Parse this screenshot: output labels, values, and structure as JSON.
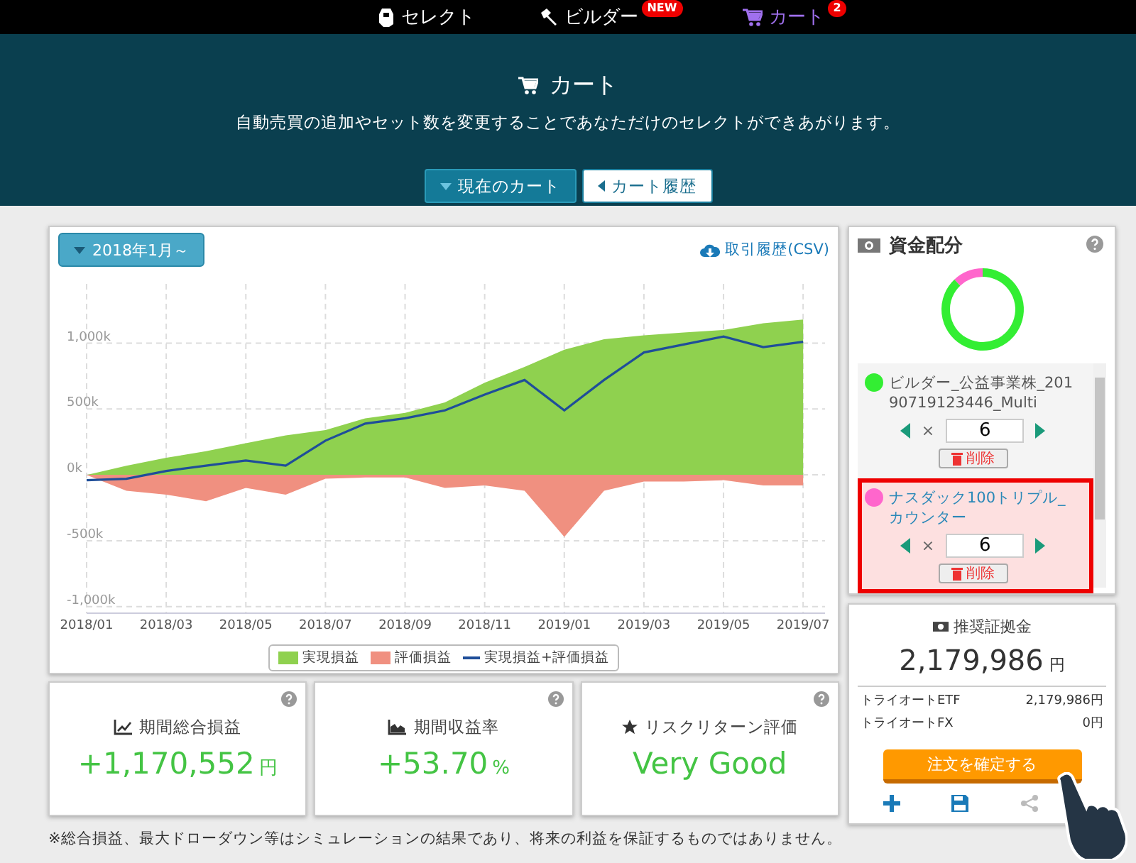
{
  "nav": {
    "items": [
      {
        "kind": "select",
        "label": "セレクト",
        "selected": false
      },
      {
        "kind": "builder",
        "label": "ビルダー",
        "badge": "NEW",
        "selected": false
      },
      {
        "kind": "cart",
        "label": "カート",
        "badge": "2",
        "selected": true
      }
    ]
  },
  "header": {
    "title": "カート",
    "subtitle": "自動売買の追加やセット数を変更することであなただけのセレクトができあがります。",
    "buttons": [
      {
        "label": "現在のカート",
        "selected": true
      },
      {
        "label": "カート履歴",
        "selected": false
      }
    ]
  },
  "performance": {
    "period_button": "2018年1月～",
    "csv_link": "取引履歴(CSV)",
    "chart_data": {
      "type": "area",
      "categories": [
        "2018/01",
        null,
        "2018/03",
        null,
        "2018/05",
        null,
        "2018/07",
        null,
        "2018/09",
        null,
        "2018/11",
        null,
        "2019/01",
        null,
        "2019/03",
        null,
        "2019/05",
        null,
        "2019/07"
      ],
      "yticks": [
        {
          "value": -1000000,
          "label": "-1,000k"
        },
        {
          "value": -500000,
          "label": "-500k"
        },
        {
          "value": 0,
          "label": "0k"
        },
        {
          "value": 500000,
          "label": "500k"
        },
        {
          "value": 1000000,
          "label": "1,000k"
        }
      ],
      "ylim": [
        -1050000,
        1450000
      ],
      "grid": true,
      "series": [
        {
          "name": "実現損益",
          "type": "area",
          "color": "#8fd14f",
          "values": [
            0,
            70000,
            130000,
            180000,
            240000,
            300000,
            340000,
            430000,
            470000,
            550000,
            700000,
            820000,
            950000,
            1030000,
            1060000,
            1080000,
            1100000,
            1150000,
            1180000
          ]
        },
        {
          "name": "評価損益",
          "type": "area",
          "color": "#f09080",
          "values": [
            0,
            -120000,
            -150000,
            -200000,
            -100000,
            -150000,
            -30000,
            -20000,
            -20000,
            -100000,
            -80000,
            -120000,
            -470000,
            -120000,
            -50000,
            -50000,
            -40000,
            -80000,
            -80000
          ]
        },
        {
          "name": "実現損益+評価損益",
          "type": "line",
          "color": "#1f4e99",
          "values": [
            -40000,
            -30000,
            30000,
            70000,
            110000,
            70000,
            260000,
            390000,
            430000,
            490000,
            610000,
            720000,
            490000,
            720000,
            930000,
            990000,
            1050000,
            970000,
            1010000
          ]
        }
      ]
    }
  },
  "allocation": {
    "title": "資金配分",
    "items": [
      {
        "name": "ビルダー_公益事業株_20190719123446_Multi",
        "color": "#33ee33",
        "quantity": "6",
        "multiplier": "×",
        "delete_label": "削除",
        "selected": false
      },
      {
        "name": "ナスダック100トリプル_カウンター",
        "color": "#ff66cc",
        "quantity": "6",
        "multiplier": "×",
        "delete_label": "削除",
        "selected": true
      }
    ]
  },
  "margin": {
    "title": "推奨証拠金",
    "amount": "2,179,986",
    "unit": "円",
    "breakdown": [
      {
        "label": "トライオートETF",
        "value": "2,179,986円"
      },
      {
        "label": "トライオートFX",
        "value": "0円"
      }
    ],
    "confirm_button": "注文を確定する"
  },
  "stats": [
    {
      "kind": "line",
      "title": "期間総合損益",
      "value": "+1,170,552",
      "unit": "円"
    },
    {
      "kind": "area",
      "title": "期間収益率",
      "value": "+53.70",
      "unit": "%"
    },
    {
      "kind": "star",
      "title": "リスクリターン評価",
      "value": "Very Good"
    }
  ],
  "notes": [
    "※総合損益、最大ドローダウン等はシミュレーションの結果であり、将来の利益を保証するものではありません。"
  ]
}
